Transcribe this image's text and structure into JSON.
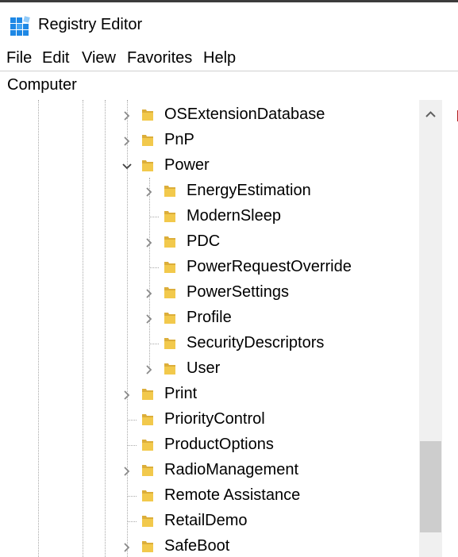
{
  "window": {
    "title": "Registry Editor"
  },
  "menu": [
    {
      "label": "File"
    },
    {
      "label": "Edit"
    },
    {
      "label": "View"
    },
    {
      "label": "Favorites"
    },
    {
      "label": "Help"
    }
  ],
  "address": {
    "path": "Computer"
  },
  "icons": {
    "expander_collapsed": "chevron-right-icon",
    "expander_expanded": "chevron-down-icon",
    "folder": "folder-icon"
  },
  "colors": {
    "folder": "#f2c94c",
    "scroll_thumb": "#cdcdcd"
  },
  "tree": [
    {
      "label": "OSExtensionDatabase",
      "level": 0,
      "expander": "collapsed"
    },
    {
      "label": "PnP",
      "level": 0,
      "expander": "collapsed"
    },
    {
      "label": "Power",
      "level": 0,
      "expander": "expanded"
    },
    {
      "label": "EnergyEstimation",
      "level": 1,
      "expander": "collapsed"
    },
    {
      "label": "ModernSleep",
      "level": 1,
      "expander": "none"
    },
    {
      "label": "PDC",
      "level": 1,
      "expander": "collapsed"
    },
    {
      "label": "PowerRequestOverride",
      "level": 1,
      "expander": "none"
    },
    {
      "label": "PowerSettings",
      "level": 1,
      "expander": "collapsed"
    },
    {
      "label": "Profile",
      "level": 1,
      "expander": "collapsed"
    },
    {
      "label": "SecurityDescriptors",
      "level": 1,
      "expander": "none"
    },
    {
      "label": "User",
      "level": 1,
      "expander": "collapsed"
    },
    {
      "label": "Print",
      "level": 0,
      "expander": "collapsed"
    },
    {
      "label": "PriorityControl",
      "level": 0,
      "expander": "none"
    },
    {
      "label": "ProductOptions",
      "level": 0,
      "expander": "none"
    },
    {
      "label": "RadioManagement",
      "level": 0,
      "expander": "collapsed"
    },
    {
      "label": "Remote Assistance",
      "level": 0,
      "expander": "none"
    },
    {
      "label": "RetailDemo",
      "level": 0,
      "expander": "none"
    },
    {
      "label": "SafeBoot",
      "level": 0,
      "expander": "collapsed"
    }
  ]
}
